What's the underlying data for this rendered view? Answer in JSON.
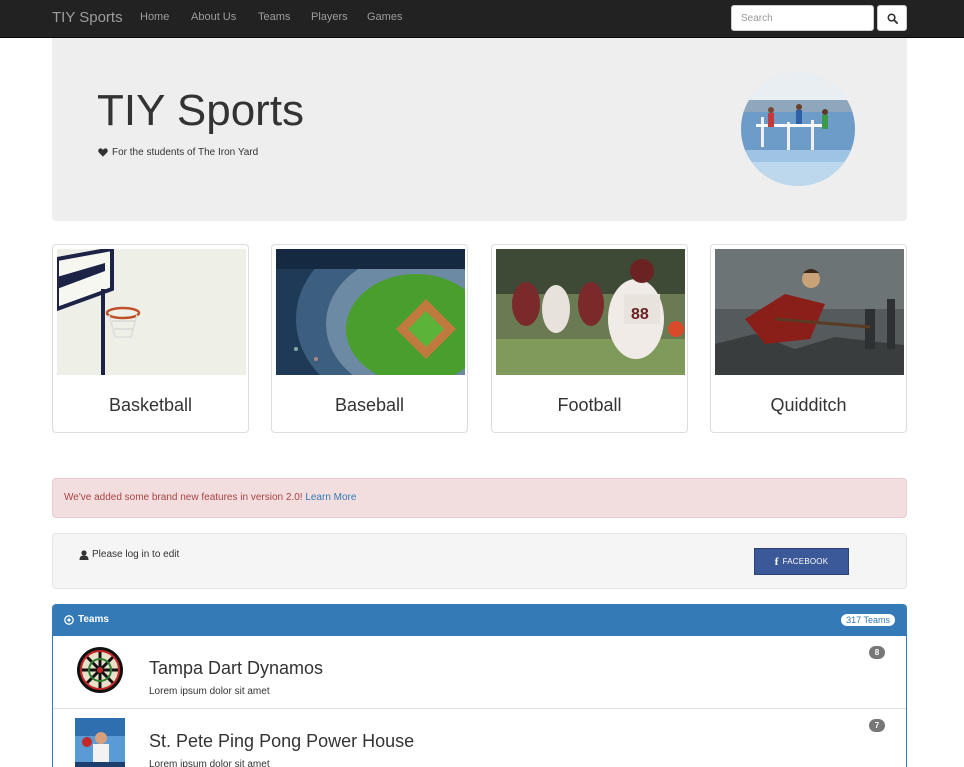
{
  "navbar": {
    "brand": "TIY Sports",
    "links": [
      "Home",
      "About Us",
      "Teams",
      "Players",
      "Games"
    ],
    "search_placeholder": "Search"
  },
  "jumbotron": {
    "title": "TIY Sports",
    "subtitle": "For the students of The Iron Yard"
  },
  "sports": [
    {
      "name": "Basketball"
    },
    {
      "name": "Baseball"
    },
    {
      "name": "Football"
    },
    {
      "name": "Quidditch"
    }
  ],
  "alert": {
    "text": "We've added some brand new features in version 2.0! ",
    "link": "Learn More"
  },
  "login": {
    "text": "Please log in to edit",
    "facebook_label": "FACEBOOK"
  },
  "teams_panel": {
    "title": "Teams",
    "count": "317 Teams",
    "teams": [
      {
        "name": "Tampa Dart Dynamos",
        "description": "Lorem ipsum dolor sit amet",
        "badge": "8"
      },
      {
        "name": "St. Pete Ping Pong Power House",
        "description": "Lorem ipsum dolor sit amet",
        "badge": "7"
      }
    ]
  },
  "colors": {
    "navbar": "#222222",
    "primary": "#337ab7",
    "alert_bg": "#f2dede",
    "alert_text": "#a94442",
    "facebook": "#3b5998"
  }
}
